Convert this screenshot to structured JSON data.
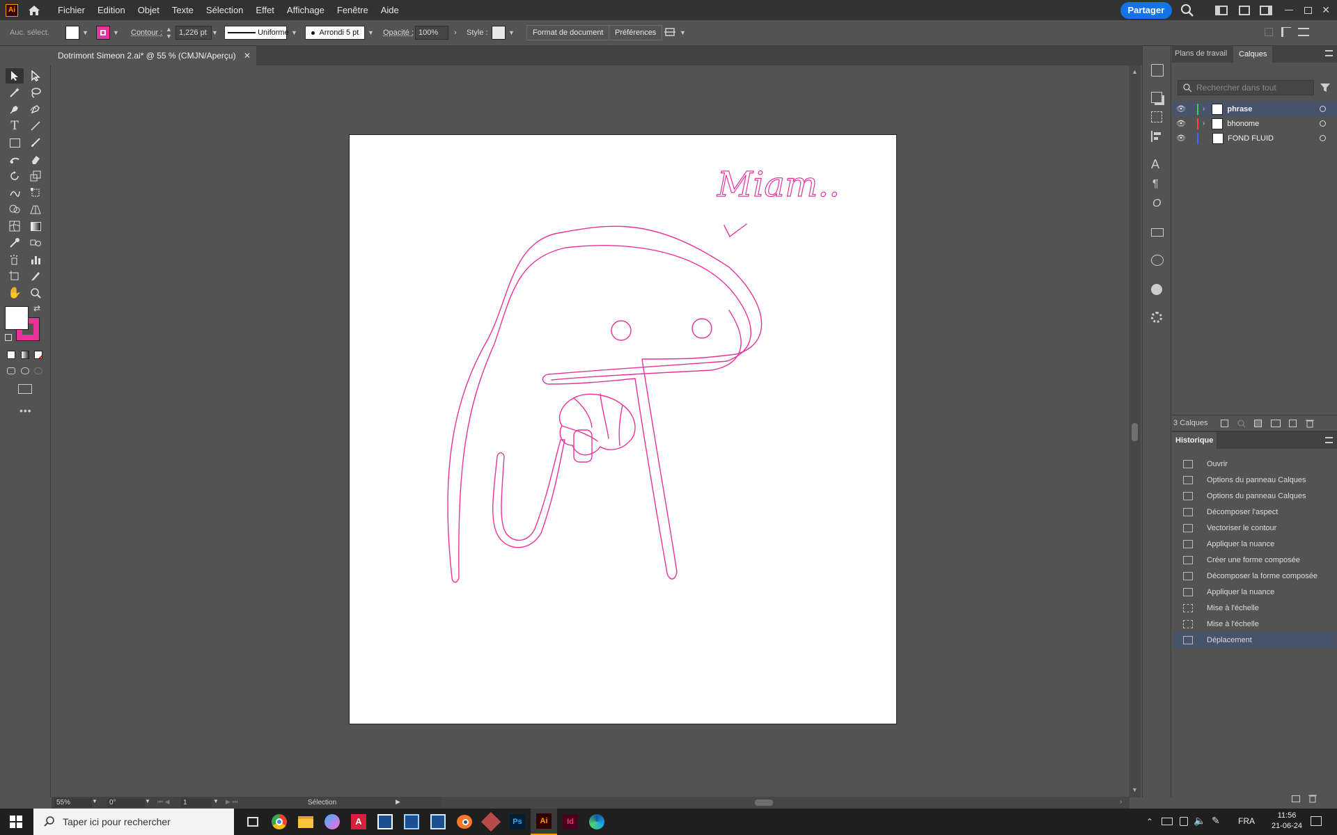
{
  "menubar": {
    "app_icon": "Ai",
    "items": [
      "Fichier",
      "Edition",
      "Objet",
      "Texte",
      "Sélection",
      "Effet",
      "Affichage",
      "Fenêtre",
      "Aide"
    ],
    "share_label": "Partager"
  },
  "controlbar": {
    "selection_label": "Auc. sélect.",
    "stroke_label": "Contour :",
    "stroke_weight": "1,226 pt",
    "profile_label": "Uniforme",
    "brush_label": "Arrondi 5 pt",
    "opacity_label": "Opacité :",
    "opacity_value": "100%",
    "style_label": "Style :",
    "doc_format_label": "Format de document",
    "preferences_label": "Préférences"
  },
  "document": {
    "tab_title": "Dotrimont Simeon 2.ai* @ 55 % (CMJN/Aperçu)",
    "artwork_text": "Miam..",
    "stroke_color": "#e8339a",
    "fill_color": "#ffffff"
  },
  "layers_panel": {
    "tabs": [
      "Plans de travail",
      "Calques"
    ],
    "active_tab": "Calques",
    "search_placeholder": "Rechercher dans tout",
    "layers": [
      {
        "name": "phrase",
        "color": "#3fd14a",
        "selected": true
      },
      {
        "name": "bhonome",
        "color": "#ff4141",
        "selected": false
      },
      {
        "name": "FOND FLUID",
        "color": "#3b6bff",
        "selected": false
      }
    ],
    "count_label": "3 Calques"
  },
  "history_panel": {
    "title": "Historique",
    "items": [
      "Ouvrir",
      "Options du panneau Calques",
      "Options du panneau Calques",
      "Décomposer l'aspect",
      "Vectoriser le contour",
      "Appliquer la nuance",
      "Créer une forme composée",
      "Décomposer la forme composée",
      "Appliquer la nuance",
      "Mise à l'échelle",
      "Mise à l'échelle",
      "Déplacement"
    ],
    "selected_index": 11
  },
  "statusbar": {
    "zoom": "55%",
    "rotation": "0°",
    "artboard_number": "1",
    "tool_label": "Sélection"
  },
  "taskbar": {
    "search_placeholder": "Taper ici pour rechercher",
    "language": "FRA",
    "time": "11:56",
    "date": "21-06-24"
  }
}
